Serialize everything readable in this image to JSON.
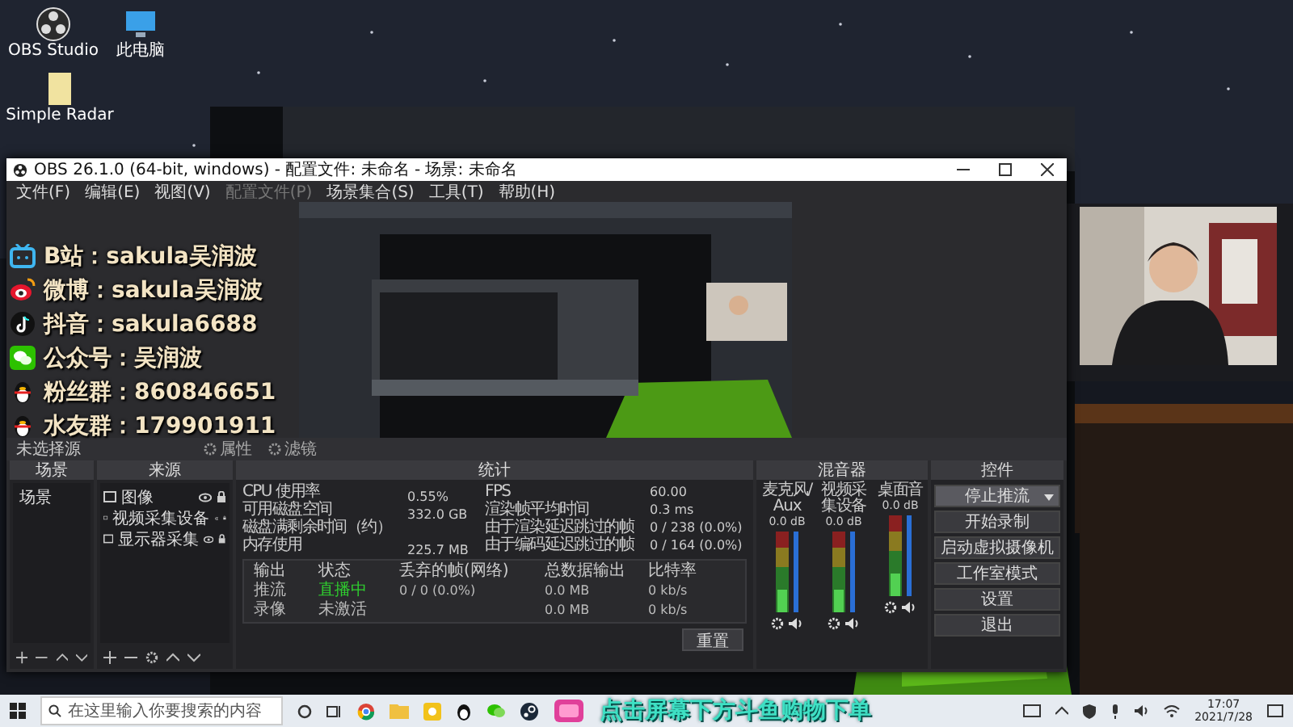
{
  "desktop_icons": [
    {
      "label": "OBS Studio"
    },
    {
      "label": "此电脑"
    },
    {
      "label": "Simple Radar"
    }
  ],
  "obs_window": {
    "title": "OBS 26.1.0 (64-bit, windows) - 配置文件: 未命名 - 场景: 未命名",
    "menu": [
      {
        "label": "文件(F)",
        "disabled": false
      },
      {
        "label": "编辑(E)",
        "disabled": false
      },
      {
        "label": "视图(V)",
        "disabled": false
      },
      {
        "label": "配置文件(P)",
        "disabled": true
      },
      {
        "label": "场景集合(S)",
        "disabled": false
      },
      {
        "label": "工具(T)",
        "disabled": false
      },
      {
        "label": "帮助(H)",
        "disabled": false
      }
    ],
    "source_toolbar": {
      "label": "未选择源",
      "buttons": [
        "属性",
        "滤镜"
      ]
    },
    "scenes": {
      "title": "场景",
      "items": [
        {
          "label": "场景",
          "selected": false
        }
      ]
    },
    "sources": {
      "title": "来源",
      "items": [
        {
          "label": "图像"
        },
        {
          "label": "视频采集设备"
        },
        {
          "label": "显示器采集"
        }
      ]
    },
    "stats": {
      "title": "统计",
      "rows": [
        {
          "label": "CPU 使用率",
          "value": "0.55%",
          "label_2": "FPS",
          "value_2": "60.00"
        },
        {
          "label": "可用磁盘空间",
          "value": "332.0 GB",
          "label_2": "渲染帧平均时间",
          "value_2": "0.3 ms"
        },
        {
          "label": "磁盘满剩余时间（约）",
          "label_2": "由于渲染延迟跳过的帧",
          "value_2": "0 / 238 (0.0%)"
        },
        {
          "label": "内存使用",
          "value": "225.7 MB",
          "label_2": "由于编码延迟跳过的帧",
          "value_2": "0 / 164 (0.0%)"
        }
      ],
      "output_columns": [
        "输出",
        "状态",
        "丢弃的帧(网络)",
        "总数据输出",
        "比特率"
      ],
      "outputs": [
        {
          "name": "推流",
          "status": "直播中",
          "active": true,
          "dropped": "0 / 0 (0.0%)",
          "total": "0.0 MB",
          "bitrate": "0 kb/s"
        },
        {
          "name": "录像",
          "status": "未激活",
          "active": false,
          "total": "0.0 MB",
          "bitrate": "0 kb/s"
        }
      ],
      "reset_button": "重置"
    },
    "mixer": {
      "title": "混音器",
      "channels": [
        {
          "name": "麦克风/Aux",
          "reading": "0.0 dB",
          "level": 1
        },
        {
          "name": "视频采集设备",
          "reading": "0.0 dB",
          "level": 1
        },
        {
          "name": "桌面音",
          "reading": "0.0 dB",
          "level": 1
        }
      ]
    },
    "controls": {
      "title": "控件",
      "buttons": [
        {
          "label": "停止推流",
          "kind": "dropdown"
        },
        {
          "label": "开始录制",
          "kind": "button"
        },
        {
          "label": "启动虚拟摄像机",
          "kind": "button"
        },
        {
          "label": "工作室模式",
          "kind": "button"
        },
        {
          "label": "设置",
          "kind": "button"
        },
        {
          "label": "退出",
          "kind": "button"
        }
      ]
    }
  },
  "overlay": {
    "lines": [
      "B站：sakula吴润波",
      "微博：sakula吴润波",
      "抖音：sakula6688",
      "公众号：吴润波",
      "粉丝群：860846651",
      "水友群：179901911"
    ]
  },
  "taskbar": {
    "search_placeholder": "在这里输入你要搜索的内容",
    "banner": "点击屏幕下方斗鱼购物下单",
    "time": "17:07",
    "date": "2021/7/28"
  }
}
